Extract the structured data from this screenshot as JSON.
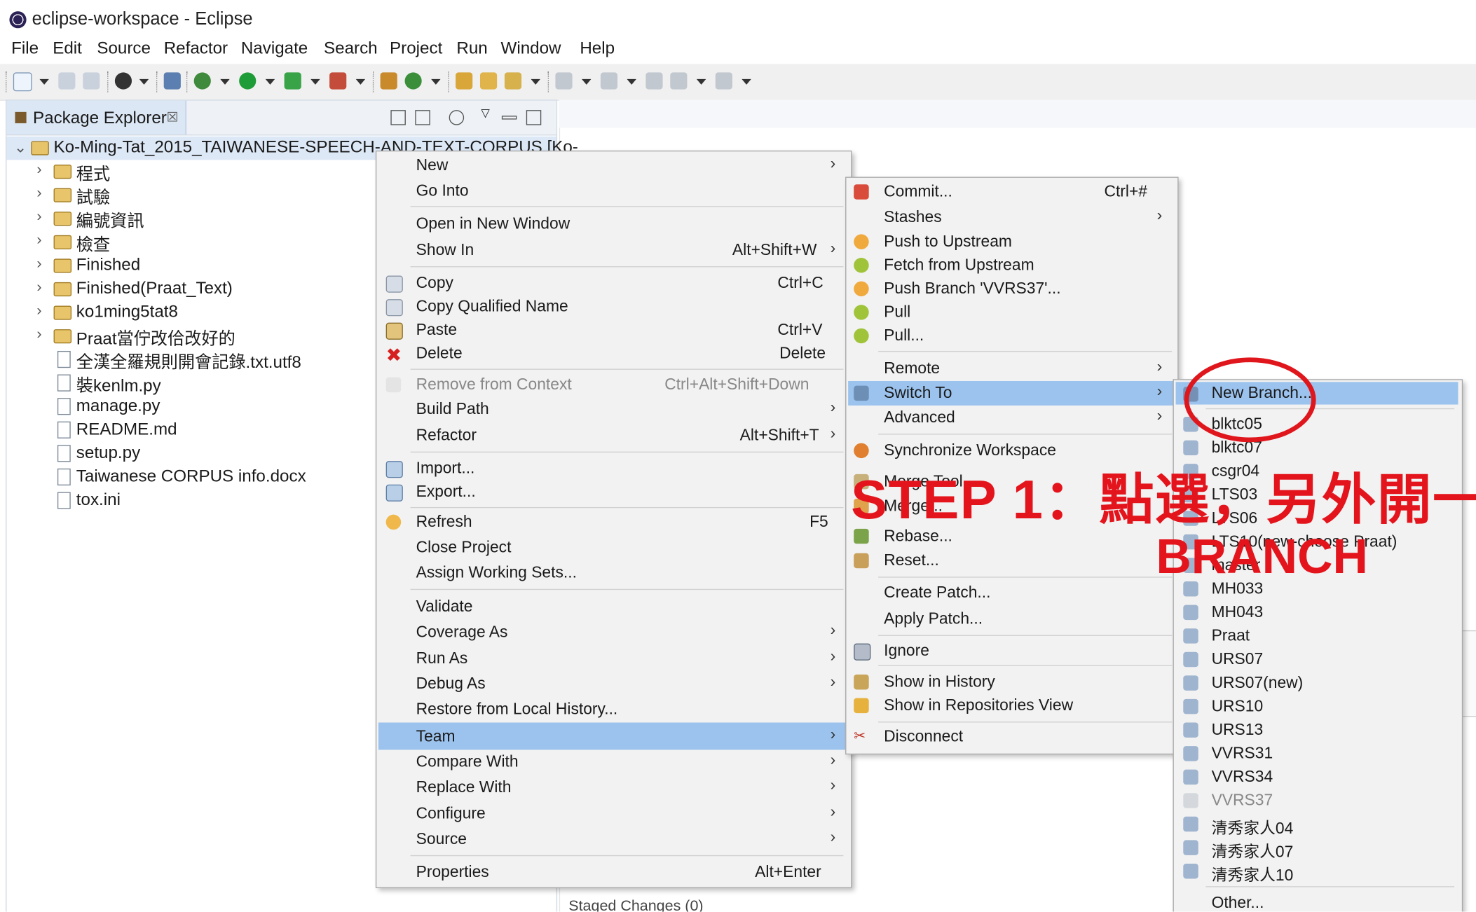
{
  "window": {
    "title": "eclipse-workspace - Eclipse"
  },
  "menubar": [
    "File",
    "Edit",
    "Source",
    "Refactor",
    "Navigate",
    "Search",
    "Project",
    "Run",
    "Window",
    "Help"
  ],
  "explorer": {
    "tab_label": "Package Explorer",
    "tab_close": "☒",
    "tree": [
      {
        "label": "Ko-Ming-Tat_2015_TAIWANESE-SPEECH-AND-TEXT-CORPUS [Ko-",
        "type": "project",
        "expanded": true
      },
      {
        "label": "程式",
        "type": "folder"
      },
      {
        "label": "試驗",
        "type": "folder"
      },
      {
        "label": "編號資訊",
        "type": "folder"
      },
      {
        "label": "檢查",
        "type": "folder"
      },
      {
        "label": "Finished",
        "type": "folder"
      },
      {
        "label": "Finished(Praat_Text)",
        "type": "folder"
      },
      {
        "label": "ko1ming5tat8",
        "type": "folder"
      },
      {
        "label": "Praat當佇改佮改好的",
        "type": "folder"
      },
      {
        "label": "全漢全羅規則開會記錄.txt.utf8",
        "type": "file"
      },
      {
        "label": "裝kenlm.py",
        "type": "file"
      },
      {
        "label": "manage.py",
        "type": "file"
      },
      {
        "label": "README.md",
        "type": "file"
      },
      {
        "label": "setup.py",
        "type": "file"
      },
      {
        "label": "Taiwanese CORPUS info.docx",
        "type": "file"
      },
      {
        "label": "tox.ini",
        "type": "file"
      }
    ]
  },
  "context_menu": [
    {
      "label": "New",
      "submenu": true
    },
    {
      "label": "Go Into"
    },
    {
      "sep": true
    },
    {
      "label": "Open in New Window"
    },
    {
      "label": "Show In",
      "accel": "Alt+Shift+W",
      "submenu": true
    },
    {
      "sep": true
    },
    {
      "label": "Copy",
      "accel": "Ctrl+C",
      "icon": "copy-icon"
    },
    {
      "label": "Copy Qualified Name",
      "icon": "copy-icon"
    },
    {
      "label": "Paste",
      "accel": "Ctrl+V",
      "icon": "paste-icon"
    },
    {
      "label": "Delete",
      "accel": "Delete",
      "icon": "delete-icon"
    },
    {
      "sep": true
    },
    {
      "label": "Remove from Context",
      "accel": "Ctrl+Alt+Shift+Down",
      "disabled": true
    },
    {
      "label": "Build Path",
      "submenu": true
    },
    {
      "label": "Refactor",
      "accel": "Alt+Shift+T",
      "submenu": true
    },
    {
      "sep": true
    },
    {
      "label": "Import...",
      "icon": "import-icon"
    },
    {
      "label": "Export...",
      "icon": "export-icon"
    },
    {
      "sep": true
    },
    {
      "label": "Refresh",
      "accel": "F5",
      "icon": "refresh-icon"
    },
    {
      "label": "Close Project"
    },
    {
      "label": "Assign Working Sets..."
    },
    {
      "sep": true
    },
    {
      "label": "Validate"
    },
    {
      "label": "Coverage As",
      "submenu": true
    },
    {
      "label": "Run As",
      "submenu": true
    },
    {
      "label": "Debug As",
      "submenu": true
    },
    {
      "label": "Restore from Local History..."
    },
    {
      "label": "Team",
      "submenu": true,
      "highlighted": true
    },
    {
      "label": "Compare With",
      "submenu": true
    },
    {
      "label": "Replace With",
      "submenu": true
    },
    {
      "label": "Configure",
      "submenu": true
    },
    {
      "label": "Source",
      "submenu": true
    },
    {
      "sep": true
    },
    {
      "label": "Properties",
      "accel": "Alt+Enter"
    }
  ],
  "team_menu": [
    {
      "label": "Commit...",
      "accel": "Ctrl+#",
      "icon": "commit-icon"
    },
    {
      "label": "Stashes",
      "submenu": true
    },
    {
      "label": "Push to Upstream",
      "icon": "push-icon"
    },
    {
      "label": "Fetch from Upstream",
      "icon": "fetch-icon"
    },
    {
      "label": "Push Branch 'VVRS37'...",
      "icon": "push-branch-icon"
    },
    {
      "label": "Pull",
      "icon": "pull-icon"
    },
    {
      "label": "Pull...",
      "icon": "pull-icon"
    },
    {
      "sep": true
    },
    {
      "label": "Remote",
      "submenu": true
    },
    {
      "label": "Switch To",
      "submenu": true,
      "highlighted": true,
      "icon": "switch-icon"
    },
    {
      "label": "Advanced",
      "submenu": true
    },
    {
      "sep": true
    },
    {
      "label": "Synchronize Workspace",
      "icon": "sync-icon"
    },
    {
      "label": "Merge Tool",
      "icon": "merge-tool-icon"
    },
    {
      "label": "Merge...",
      "icon": "merge-icon"
    },
    {
      "label": "Rebase...",
      "icon": "rebase-icon"
    },
    {
      "label": "Reset...",
      "icon": "reset-icon"
    },
    {
      "sep": true
    },
    {
      "label": "Create Patch..."
    },
    {
      "label": "Apply Patch..."
    },
    {
      "sep": true
    },
    {
      "label": "Ignore",
      "icon": "ignore-icon"
    },
    {
      "sep": true
    },
    {
      "label": "Show in History",
      "icon": "history-icon"
    },
    {
      "label": "Show in Repositories View",
      "icon": "repo-icon"
    },
    {
      "sep": true
    },
    {
      "label": "Disconnect",
      "icon": "disconnect-icon"
    }
  ],
  "switch_menu": [
    {
      "label": "New Branch...",
      "highlighted": true
    },
    {
      "sep": true
    },
    {
      "label": "blktc05"
    },
    {
      "label": "blktc07"
    },
    {
      "label": "csgr04"
    },
    {
      "label": "LTS03"
    },
    {
      "label": "LTS06"
    },
    {
      "label": "LTS10(new-choose Praat)"
    },
    {
      "label": "master"
    },
    {
      "label": "MH033"
    },
    {
      "label": "MH043"
    },
    {
      "label": "Praat"
    },
    {
      "label": "URS07"
    },
    {
      "label": "URS07(new)"
    },
    {
      "label": "URS10"
    },
    {
      "label": "URS13"
    },
    {
      "label": "VVRS31"
    },
    {
      "label": "VVRS34"
    },
    {
      "label": "VVRS37",
      "disabled": true
    },
    {
      "label": "清秀家人04"
    },
    {
      "label": "清秀家人07"
    },
    {
      "label": "清秀家人10"
    },
    {
      "sep": true
    },
    {
      "label": "Other..."
    }
  ],
  "annotation": {
    "step_text": "STEP 1：點選，另外開一",
    "branch_text": "BRANCH",
    "color": "#e4141c"
  },
  "staged_label": "Staged Changes (0)",
  "colors": {
    "highlight": "#9bc3ee",
    "menu_bg": "#f2f2f2",
    "accent_red": "#e4141c"
  }
}
